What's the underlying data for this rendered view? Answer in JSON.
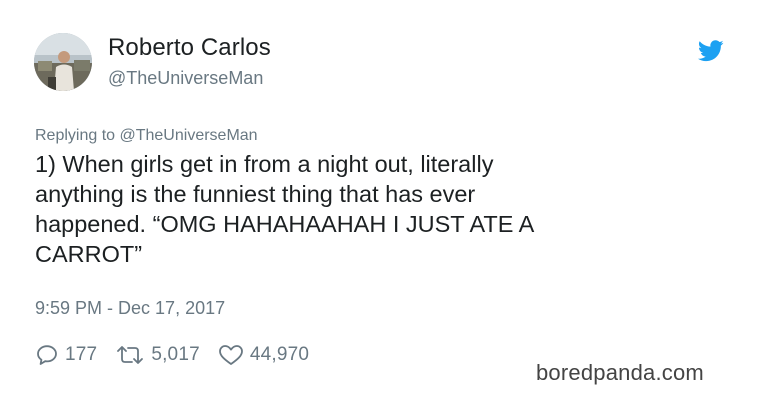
{
  "tweet": {
    "author": {
      "display_name": "Roberto Carlos",
      "handle": "@TheUniverseMan",
      "avatar_icon": "profile-photo"
    },
    "brand_icon": "twitter-bird-icon",
    "brand_color": "#1da1f2",
    "reply_context": "Replying to @TheUniverseMan",
    "text": "1) When girls get in from a night out, literally\nanything is the funniest thing that has ever\nhappened. “OMG HAHAHAAHAH I JUST ATE A\nCARROT”",
    "timestamp": "9:59 PM - Dec 17, 2017",
    "actions": {
      "replies": "177",
      "retweets": "5,017",
      "likes": "44,970"
    }
  },
  "watermark": "boredpanda.com",
  "colors": {
    "text_primary": "#1c2022",
    "text_secondary": "#697882",
    "watermark": "#444444"
  }
}
